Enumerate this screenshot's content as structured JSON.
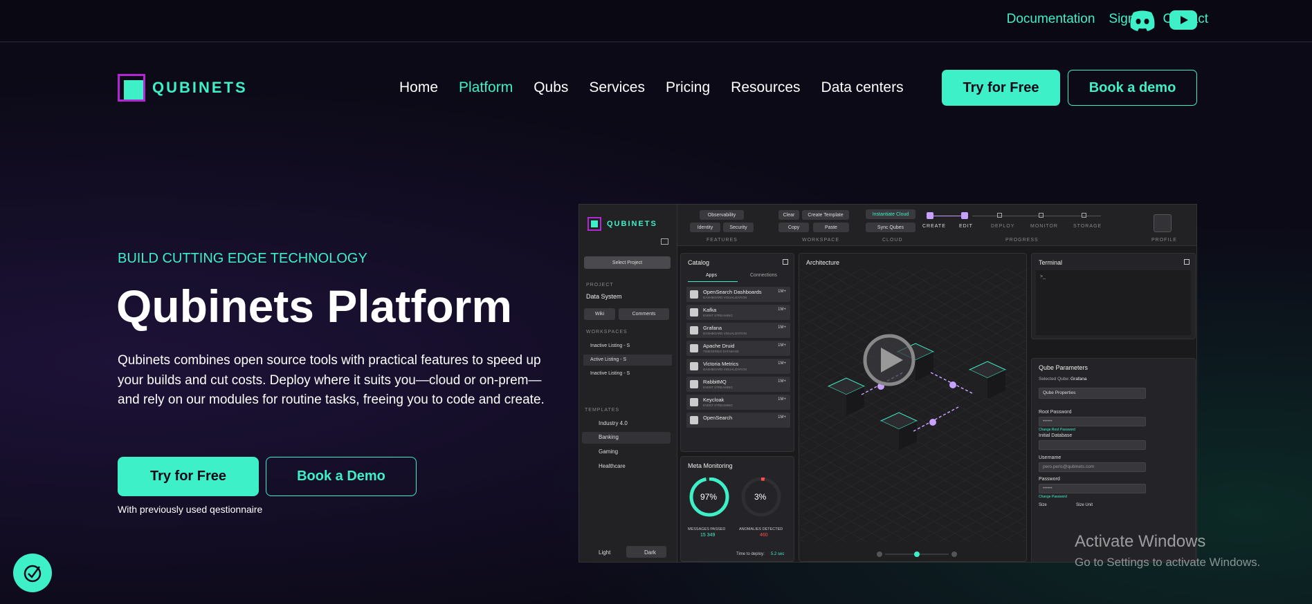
{
  "topbar": {
    "links": [
      "Documentation",
      "Sign in",
      "Contact"
    ],
    "social": [
      "discord-icon",
      "youtube-icon"
    ]
  },
  "brand": {
    "name": "QUBINETS"
  },
  "nav": {
    "items": [
      "Home",
      "Platform",
      "Qubs",
      "Services",
      "Pricing",
      "Resources",
      "Data centers"
    ],
    "active": "Platform",
    "try_label": "Try for Free",
    "demo_label": "Book a demo"
  },
  "hero": {
    "eyebrow": "BUILD CUTTING EDGE TECHNOLOGY",
    "title": "Qubinets Platform",
    "description": "Qubinets combines open source tools with practical features to speed up your builds and cut costs. Deploy where it suits you—cloud or on-prem—and rely on our modules for routine tasks, freeing you to code and create.",
    "cta_primary": "Try for Free",
    "cta_secondary": "Book a Demo",
    "note": "With previously used qestionnaire"
  },
  "colors": {
    "accent": "#3ef0c8",
    "brand_purple": "#b326d6",
    "background": "#0c0a17"
  },
  "app": {
    "brand": "QUBINETS",
    "select_project": "Select Project",
    "project_label": "PROJECT",
    "project_name": "Data System",
    "wiki": "Wiki",
    "comments": "Comments",
    "workspaces_label": "WORKSPACES",
    "workspaces": [
      "Inactive Listing - S",
      "Active Listing - S",
      "Inactive Listing - S"
    ],
    "templates_label": "TEMPLATES",
    "templates": [
      "Industry 4.0",
      "Banking",
      "Gaming",
      "Healthcare"
    ],
    "theme_light": "Light",
    "theme_dark": "Dark",
    "features": {
      "label": "FEATURES",
      "buttons": [
        "Observability",
        "Identity",
        "Security"
      ]
    },
    "workspace": {
      "label": "WORKSPACE",
      "buttons": [
        "Clear",
        "Create Template",
        "Copy",
        "Paste"
      ]
    },
    "cloud": {
      "label": "CLOUD",
      "buttons": [
        "Instantiate Cloud",
        "Sync Qubes"
      ]
    },
    "progress": {
      "label": "PROGRESS",
      "steps": [
        "CREATE",
        "EDIT",
        "DEPLOY",
        "MONITOR",
        "STORAGE"
      ]
    },
    "profile": "PROFILE",
    "catalog": {
      "title": "Catalog",
      "tabs": [
        "Apps",
        "Connections"
      ],
      "items": [
        {
          "name": "OpenSearch Dashboards",
          "sub": "DASHBOARD VISUALIZATION",
          "users": "1M+"
        },
        {
          "name": "Kafka",
          "sub": "EVENT STREAMING",
          "users": "1M+"
        },
        {
          "name": "Grafana",
          "sub": "DASHBOARD VISUALIZATION",
          "users": "1M+"
        },
        {
          "name": "Apache Druid",
          "sub": "TIMESERIES DATABASE",
          "users": "1M+"
        },
        {
          "name": "Victoria Metrics",
          "sub": "DASHBOARD VISUALIZATION",
          "users": "1M+"
        },
        {
          "name": "RabbitMQ",
          "sub": "EVENT STREAMING",
          "users": "1M+"
        },
        {
          "name": "Keycloak",
          "sub": "EVENT STREAMING",
          "users": "1M+"
        },
        {
          "name": "OpenSearch",
          "sub": "",
          "users": "1M+"
        }
      ]
    },
    "architecture": {
      "title": "Architecture"
    },
    "terminal": {
      "title": "Terminal",
      "prompt": ">_"
    },
    "meta": {
      "title": "Meta Monitoring",
      "messages_value": "97%",
      "messages_label": "MESSAGES PASSED",
      "messages_count": "15 349",
      "messages_fraction": 0.97,
      "anomalies_value": "3%",
      "anomalies_label": "ANOMALIES DETECTED",
      "anomalies_count": "460",
      "anomalies_fraction": 0.03,
      "deploy_label": "Time to deploy:",
      "deploy_value": "5.2 sec"
    },
    "qube": {
      "title": "Qube Parameters",
      "selected_label": "Selected Qube:",
      "selected_value": "Grafana",
      "properties": "Qube Properties",
      "root_password_label": "Root Password",
      "root_password_value": "••••••",
      "change_root": "Change Root Password",
      "initial_db_label": "Initial Database",
      "username_label": "Username",
      "username_value": "pero.peric@qubinets.com",
      "password_label": "Password",
      "password_value": "••••••",
      "change_password": "Change Password",
      "size_label": "Size",
      "size_unit_label": "Size Unit"
    },
    "zoom_fraction": 0.5
  },
  "watermark": {
    "line1": "Activate Windows",
    "line2": "Go to Settings to activate Windows."
  }
}
